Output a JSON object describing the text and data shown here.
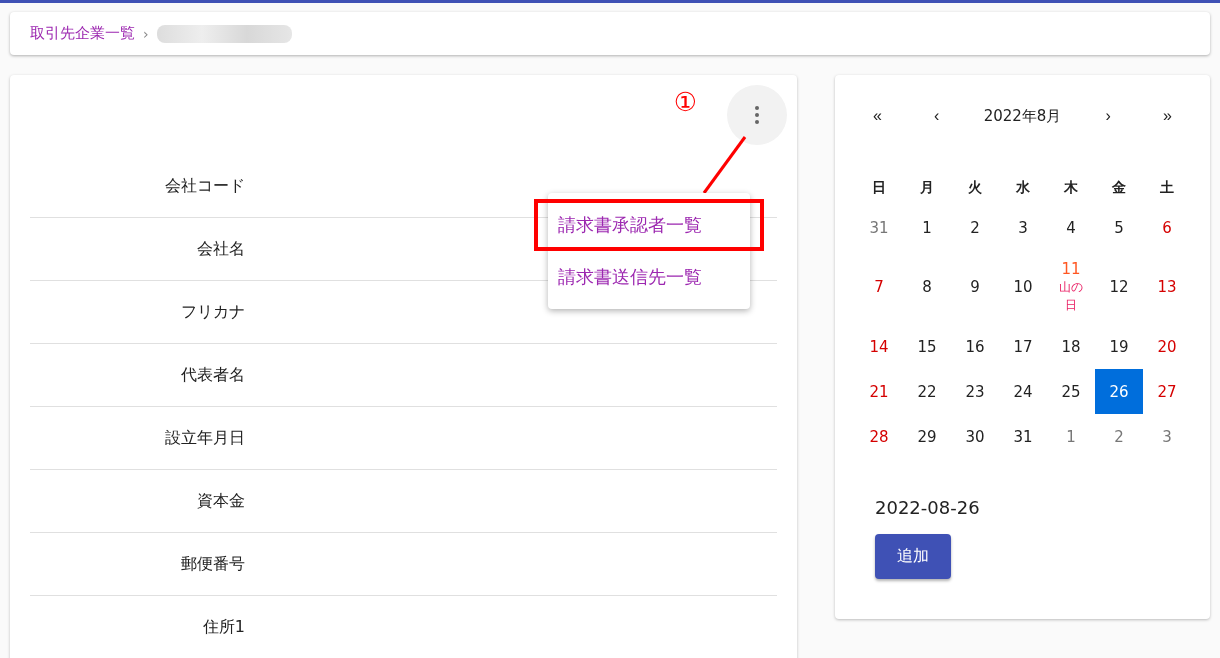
{
  "breadcrumb": {
    "items": [
      "取引先企業一覧"
    ],
    "separator": "›"
  },
  "detail": {
    "fields": [
      {
        "label": "会社コード"
      },
      {
        "label": "会社名"
      },
      {
        "label": "フリカナ"
      },
      {
        "label": "代表者名"
      },
      {
        "label": "設立年月日"
      },
      {
        "label": "資本金"
      },
      {
        "label": "郵便番号"
      },
      {
        "label": "住所1"
      }
    ],
    "menu": {
      "open": true,
      "items": [
        {
          "label": "請求書承認者一覧",
          "highlighted": true
        },
        {
          "label": "請求書送信先一覧",
          "highlighted": false
        }
      ]
    },
    "annotation": {
      "label": "①"
    }
  },
  "calendar": {
    "nav": {
      "first": "«",
      "prev": "‹",
      "title": "2022年8月",
      "next": "›",
      "last": "»"
    },
    "weekdays": [
      "日",
      "月",
      "火",
      "水",
      "木",
      "金",
      "土"
    ],
    "weeks": [
      [
        {
          "day": "31",
          "kind": "outside",
          "selected": false
        },
        {
          "day": "1",
          "kind": "normal",
          "selected": false
        },
        {
          "day": "2",
          "kind": "normal",
          "selected": false
        },
        {
          "day": "3",
          "kind": "normal",
          "selected": false
        },
        {
          "day": "4",
          "kind": "normal",
          "selected": false
        },
        {
          "day": "5",
          "kind": "normal",
          "selected": false
        },
        {
          "day": "6",
          "kind": "weekend",
          "selected": false
        }
      ],
      [
        {
          "day": "7",
          "kind": "weekend",
          "selected": false
        },
        {
          "day": "8",
          "kind": "normal",
          "selected": false
        },
        {
          "day": "9",
          "kind": "normal",
          "selected": false
        },
        {
          "day": "10",
          "kind": "normal",
          "selected": false
        },
        {
          "day": "11",
          "kind": "holiday",
          "note": "山の日",
          "selected": false
        },
        {
          "day": "12",
          "kind": "normal",
          "selected": false
        },
        {
          "day": "13",
          "kind": "weekend",
          "selected": false
        }
      ],
      [
        {
          "day": "14",
          "kind": "weekend",
          "selected": false
        },
        {
          "day": "15",
          "kind": "normal",
          "selected": false
        },
        {
          "day": "16",
          "kind": "normal",
          "selected": false
        },
        {
          "day": "17",
          "kind": "normal",
          "selected": false
        },
        {
          "day": "18",
          "kind": "normal",
          "selected": false
        },
        {
          "day": "19",
          "kind": "normal",
          "selected": false
        },
        {
          "day": "20",
          "kind": "weekend",
          "selected": false
        }
      ],
      [
        {
          "day": "21",
          "kind": "weekend",
          "selected": false
        },
        {
          "day": "22",
          "kind": "normal",
          "selected": false
        },
        {
          "day": "23",
          "kind": "normal",
          "selected": false
        },
        {
          "day": "24",
          "kind": "normal",
          "selected": false
        },
        {
          "day": "25",
          "kind": "normal",
          "selected": false
        },
        {
          "day": "26",
          "kind": "normal",
          "selected": true
        },
        {
          "day": "27",
          "kind": "weekend",
          "selected": false
        }
      ],
      [
        {
          "day": "28",
          "kind": "weekend",
          "selected": false
        },
        {
          "day": "29",
          "kind": "normal",
          "selected": false
        },
        {
          "day": "30",
          "kind": "normal",
          "selected": false
        },
        {
          "day": "31",
          "kind": "normal",
          "selected": false
        },
        {
          "day": "1",
          "kind": "outside",
          "selected": false
        },
        {
          "day": "2",
          "kind": "outside",
          "selected": false
        },
        {
          "day": "3",
          "kind": "outside",
          "selected": false
        }
      ]
    ],
    "selected_date": "2022-08-26",
    "add_button": "追加"
  }
}
